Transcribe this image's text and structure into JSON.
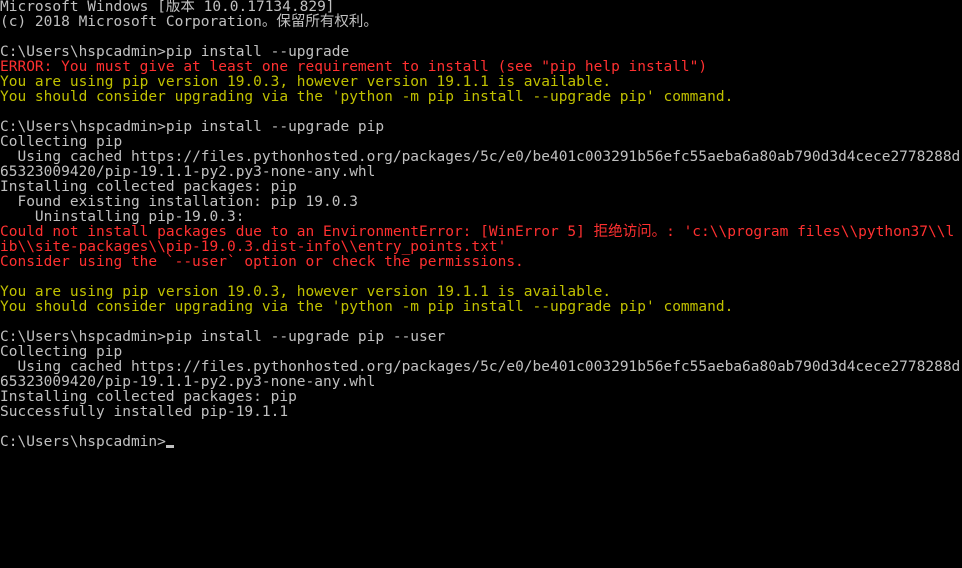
{
  "lines": [
    {
      "cls": "white",
      "text": "Microsoft Windows [版本 10.0.17134.829]"
    },
    {
      "cls": "white",
      "text": "(c) 2018 Microsoft Corporation。保留所有权利。"
    },
    {
      "cls": "white",
      "text": ""
    },
    {
      "cls": "white",
      "text": "C:\\Users\\hspcadmin>pip install --upgrade"
    },
    {
      "cls": "red",
      "text": "ERROR: You must give at least one requirement to install (see \"pip help install\")"
    },
    {
      "cls": "yellow",
      "text": "You are using pip version 19.0.3, however version 19.1.1 is available."
    },
    {
      "cls": "yellow",
      "text": "You should consider upgrading via the 'python -m pip install --upgrade pip' command."
    },
    {
      "cls": "white",
      "text": ""
    },
    {
      "cls": "white",
      "text": "C:\\Users\\hspcadmin>pip install --upgrade pip"
    },
    {
      "cls": "white",
      "text": "Collecting pip"
    },
    {
      "cls": "white",
      "text": "  Using cached https://files.pythonhosted.org/packages/5c/e0/be401c003291b56efc55aeba6a80ab790d3d4cece2778288d65323009420/pip-19.1.1-py2.py3-none-any.whl"
    },
    {
      "cls": "white",
      "text": "Installing collected packages: pip"
    },
    {
      "cls": "white",
      "text": "  Found existing installation: pip 19.0.3"
    },
    {
      "cls": "white",
      "text": "    Uninstalling pip-19.0.3:"
    },
    {
      "cls": "red",
      "text": "Could not install packages due to an EnvironmentError: [WinError 5] 拒绝访问。: 'c:\\\\program files\\\\python37\\\\lib\\\\site-packages\\\\pip-19.0.3.dist-info\\\\entry_points.txt'"
    },
    {
      "cls": "red",
      "text": "Consider using the `--user` option or check the permissions."
    },
    {
      "cls": "red",
      "text": ""
    },
    {
      "cls": "yellow",
      "text": "You are using pip version 19.0.3, however version 19.1.1 is available."
    },
    {
      "cls": "yellow",
      "text": "You should consider upgrading via the 'python -m pip install --upgrade pip' command."
    },
    {
      "cls": "white",
      "text": ""
    },
    {
      "cls": "white",
      "text": "C:\\Users\\hspcadmin>pip install --upgrade pip --user"
    },
    {
      "cls": "white",
      "text": "Collecting pip"
    },
    {
      "cls": "white",
      "text": "  Using cached https://files.pythonhosted.org/packages/5c/e0/be401c003291b56efc55aeba6a80ab790d3d4cece2778288d65323009420/pip-19.1.1-py2.py3-none-any.whl"
    },
    {
      "cls": "white",
      "text": "Installing collected packages: pip"
    },
    {
      "cls": "white",
      "text": "Successfully installed pip-19.1.1"
    },
    {
      "cls": "white",
      "text": ""
    }
  ],
  "prompt_line": "C:\\Users\\hspcadmin>",
  "colors": {
    "bg": "#000000",
    "fg": "#c0c0c0",
    "error": "#ff3030",
    "warn": "#c0c000"
  }
}
